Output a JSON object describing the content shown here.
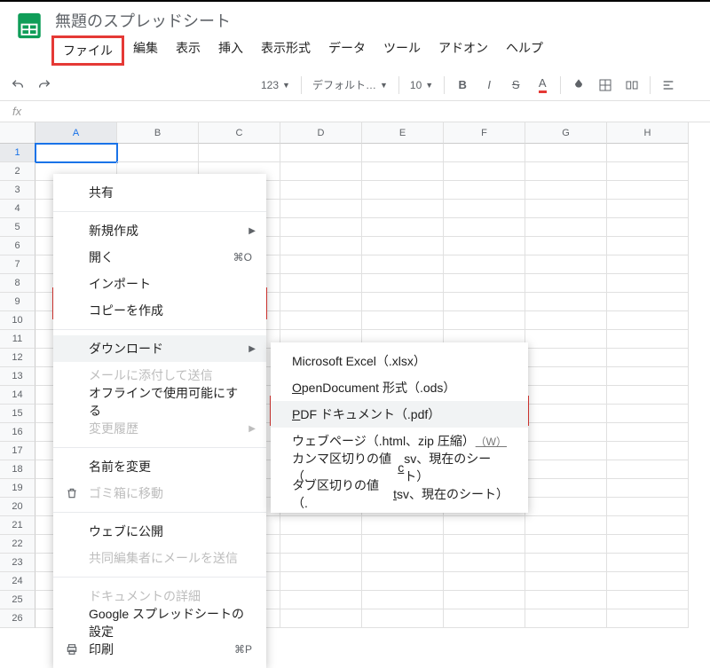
{
  "doc": {
    "title": "無題のスプレッドシート"
  },
  "menubar": {
    "file": "ファイル",
    "edit": "編集",
    "view": "表示",
    "insert": "挿入",
    "format": "表示形式",
    "data": "データ",
    "tools": "ツール",
    "addons": "アドオン",
    "help": "ヘルプ"
  },
  "toolbar": {
    "zoom": "123",
    "font": "デフォルト…",
    "fontsize": "10"
  },
  "fx": "fx",
  "cols": [
    "A",
    "B",
    "C",
    "D",
    "E",
    "F",
    "G",
    "H"
  ],
  "rows": [
    "1",
    "2",
    "3",
    "4",
    "5",
    "6",
    "7",
    "8",
    "9",
    "10",
    "11",
    "12",
    "13",
    "14",
    "15",
    "16",
    "17",
    "18",
    "19",
    "20",
    "21",
    "22",
    "23",
    "24",
    "25",
    "26"
  ],
  "file_menu": {
    "share": "共有",
    "new": "新規作成",
    "open": "開く",
    "open_sc": "⌘O",
    "import": "インポート",
    "make_copy": "コピーを作成",
    "download": "ダウンロード",
    "email_attach": "メールに添付して送信",
    "offline": "オフラインで使用可能にする",
    "version": "変更履歴",
    "rename": "名前を変更",
    "trash": "ゴミ箱に移動",
    "publish": "ウェブに公開",
    "email_collab": "共同編集者にメールを送信",
    "details": "ドキュメントの詳細",
    "settings": "Google スプレッドシートの設定",
    "print": "印刷",
    "print_sc": "⌘P"
  },
  "download_menu": {
    "xlsx": "Microsoft Excel（.xlsx）",
    "ods_pre": "O",
    "ods_rest": "penDocument 形式（.ods）",
    "pdf_pre": "P",
    "pdf_rest": "DF ドキュメント（.pdf）",
    "html": "ウェブページ（.html、zip 圧縮）",
    "html_suffix": "（W）",
    "csv_pre": "カンマ区切りの値（.",
    "csv_u": "c",
    "csv_rest": "sv、現在のシート）",
    "tsv_pre": "タブ区切りの値（.",
    "tsv_u": "t",
    "tsv_rest": "sv、現在のシート）"
  }
}
